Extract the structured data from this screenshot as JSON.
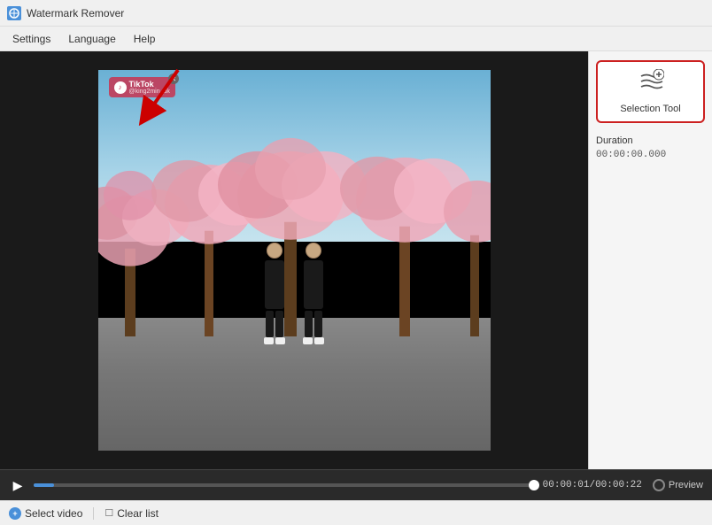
{
  "titleBar": {
    "appName": "Watermark Remover",
    "iconText": "W"
  },
  "menuBar": {
    "items": [
      {
        "id": "settings",
        "label": "Settings"
      },
      {
        "id": "language",
        "label": "Language"
      },
      {
        "id": "help",
        "label": "Help"
      }
    ]
  },
  "rightPanel": {
    "selectionTool": {
      "label": "Selection Tool",
      "iconUnicode": "≋"
    },
    "duration": {
      "label": "Duration",
      "value": "00:00:00.000"
    }
  },
  "bottomControls": {
    "playIcon": "▶",
    "currentTime": "00:00:01",
    "totalTime": "00:00:22",
    "timeSeparator": "/",
    "previewLabel": "Preview",
    "progressPercent": 4
  },
  "footer": {
    "selectVideoLabel": "Select video",
    "clearListLabel": "Clear list",
    "addIcon": "+"
  },
  "watermark": {
    "text": "TikTok",
    "subText": "@king2min_uk"
  }
}
